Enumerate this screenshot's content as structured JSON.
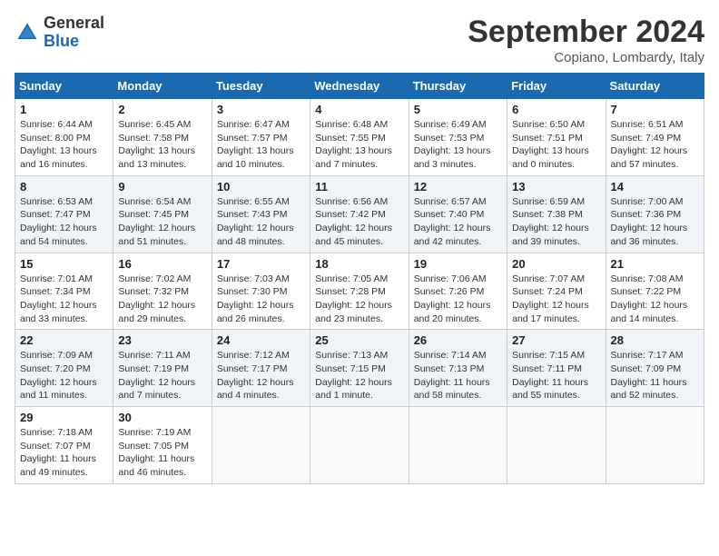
{
  "logo": {
    "general": "General",
    "blue": "Blue"
  },
  "title": "September 2024",
  "location": "Copiano, Lombardy, Italy",
  "headers": [
    "Sunday",
    "Monday",
    "Tuesday",
    "Wednesday",
    "Thursday",
    "Friday",
    "Saturday"
  ],
  "weeks": [
    [
      {
        "day": "1",
        "sunrise": "6:44 AM",
        "sunset": "8:00 PM",
        "daylight": "13 hours and 16 minutes."
      },
      {
        "day": "2",
        "sunrise": "6:45 AM",
        "sunset": "7:58 PM",
        "daylight": "13 hours and 13 minutes."
      },
      {
        "day": "3",
        "sunrise": "6:47 AM",
        "sunset": "7:57 PM",
        "daylight": "13 hours and 10 minutes."
      },
      {
        "day": "4",
        "sunrise": "6:48 AM",
        "sunset": "7:55 PM",
        "daylight": "13 hours and 7 minutes."
      },
      {
        "day": "5",
        "sunrise": "6:49 AM",
        "sunset": "7:53 PM",
        "daylight": "13 hours and 3 minutes."
      },
      {
        "day": "6",
        "sunrise": "6:50 AM",
        "sunset": "7:51 PM",
        "daylight": "13 hours and 0 minutes."
      },
      {
        "day": "7",
        "sunrise": "6:51 AM",
        "sunset": "7:49 PM",
        "daylight": "12 hours and 57 minutes."
      }
    ],
    [
      {
        "day": "8",
        "sunrise": "6:53 AM",
        "sunset": "7:47 PM",
        "daylight": "12 hours and 54 minutes."
      },
      {
        "day": "9",
        "sunrise": "6:54 AM",
        "sunset": "7:45 PM",
        "daylight": "12 hours and 51 minutes."
      },
      {
        "day": "10",
        "sunrise": "6:55 AM",
        "sunset": "7:43 PM",
        "daylight": "12 hours and 48 minutes."
      },
      {
        "day": "11",
        "sunrise": "6:56 AM",
        "sunset": "7:42 PM",
        "daylight": "12 hours and 45 minutes."
      },
      {
        "day": "12",
        "sunrise": "6:57 AM",
        "sunset": "7:40 PM",
        "daylight": "12 hours and 42 minutes."
      },
      {
        "day": "13",
        "sunrise": "6:59 AM",
        "sunset": "7:38 PM",
        "daylight": "12 hours and 39 minutes."
      },
      {
        "day": "14",
        "sunrise": "7:00 AM",
        "sunset": "7:36 PM",
        "daylight": "12 hours and 36 minutes."
      }
    ],
    [
      {
        "day": "15",
        "sunrise": "7:01 AM",
        "sunset": "7:34 PM",
        "daylight": "12 hours and 33 minutes."
      },
      {
        "day": "16",
        "sunrise": "7:02 AM",
        "sunset": "7:32 PM",
        "daylight": "12 hours and 29 minutes."
      },
      {
        "day": "17",
        "sunrise": "7:03 AM",
        "sunset": "7:30 PM",
        "daylight": "12 hours and 26 minutes."
      },
      {
        "day": "18",
        "sunrise": "7:05 AM",
        "sunset": "7:28 PM",
        "daylight": "12 hours and 23 minutes."
      },
      {
        "day": "19",
        "sunrise": "7:06 AM",
        "sunset": "7:26 PM",
        "daylight": "12 hours and 20 minutes."
      },
      {
        "day": "20",
        "sunrise": "7:07 AM",
        "sunset": "7:24 PM",
        "daylight": "12 hours and 17 minutes."
      },
      {
        "day": "21",
        "sunrise": "7:08 AM",
        "sunset": "7:22 PM",
        "daylight": "12 hours and 14 minutes."
      }
    ],
    [
      {
        "day": "22",
        "sunrise": "7:09 AM",
        "sunset": "7:20 PM",
        "daylight": "12 hours and 11 minutes."
      },
      {
        "day": "23",
        "sunrise": "7:11 AM",
        "sunset": "7:19 PM",
        "daylight": "12 hours and 7 minutes."
      },
      {
        "day": "24",
        "sunrise": "7:12 AM",
        "sunset": "7:17 PM",
        "daylight": "12 hours and 4 minutes."
      },
      {
        "day": "25",
        "sunrise": "7:13 AM",
        "sunset": "7:15 PM",
        "daylight": "12 hours and 1 minute."
      },
      {
        "day": "26",
        "sunrise": "7:14 AM",
        "sunset": "7:13 PM",
        "daylight": "11 hours and 58 minutes."
      },
      {
        "day": "27",
        "sunrise": "7:15 AM",
        "sunset": "7:11 PM",
        "daylight": "11 hours and 55 minutes."
      },
      {
        "day": "28",
        "sunrise": "7:17 AM",
        "sunset": "7:09 PM",
        "daylight": "11 hours and 52 minutes."
      }
    ],
    [
      {
        "day": "29",
        "sunrise": "7:18 AM",
        "sunset": "7:07 PM",
        "daylight": "11 hours and 49 minutes."
      },
      {
        "day": "30",
        "sunrise": "7:19 AM",
        "sunset": "7:05 PM",
        "daylight": "11 hours and 46 minutes."
      },
      null,
      null,
      null,
      null,
      null
    ]
  ]
}
